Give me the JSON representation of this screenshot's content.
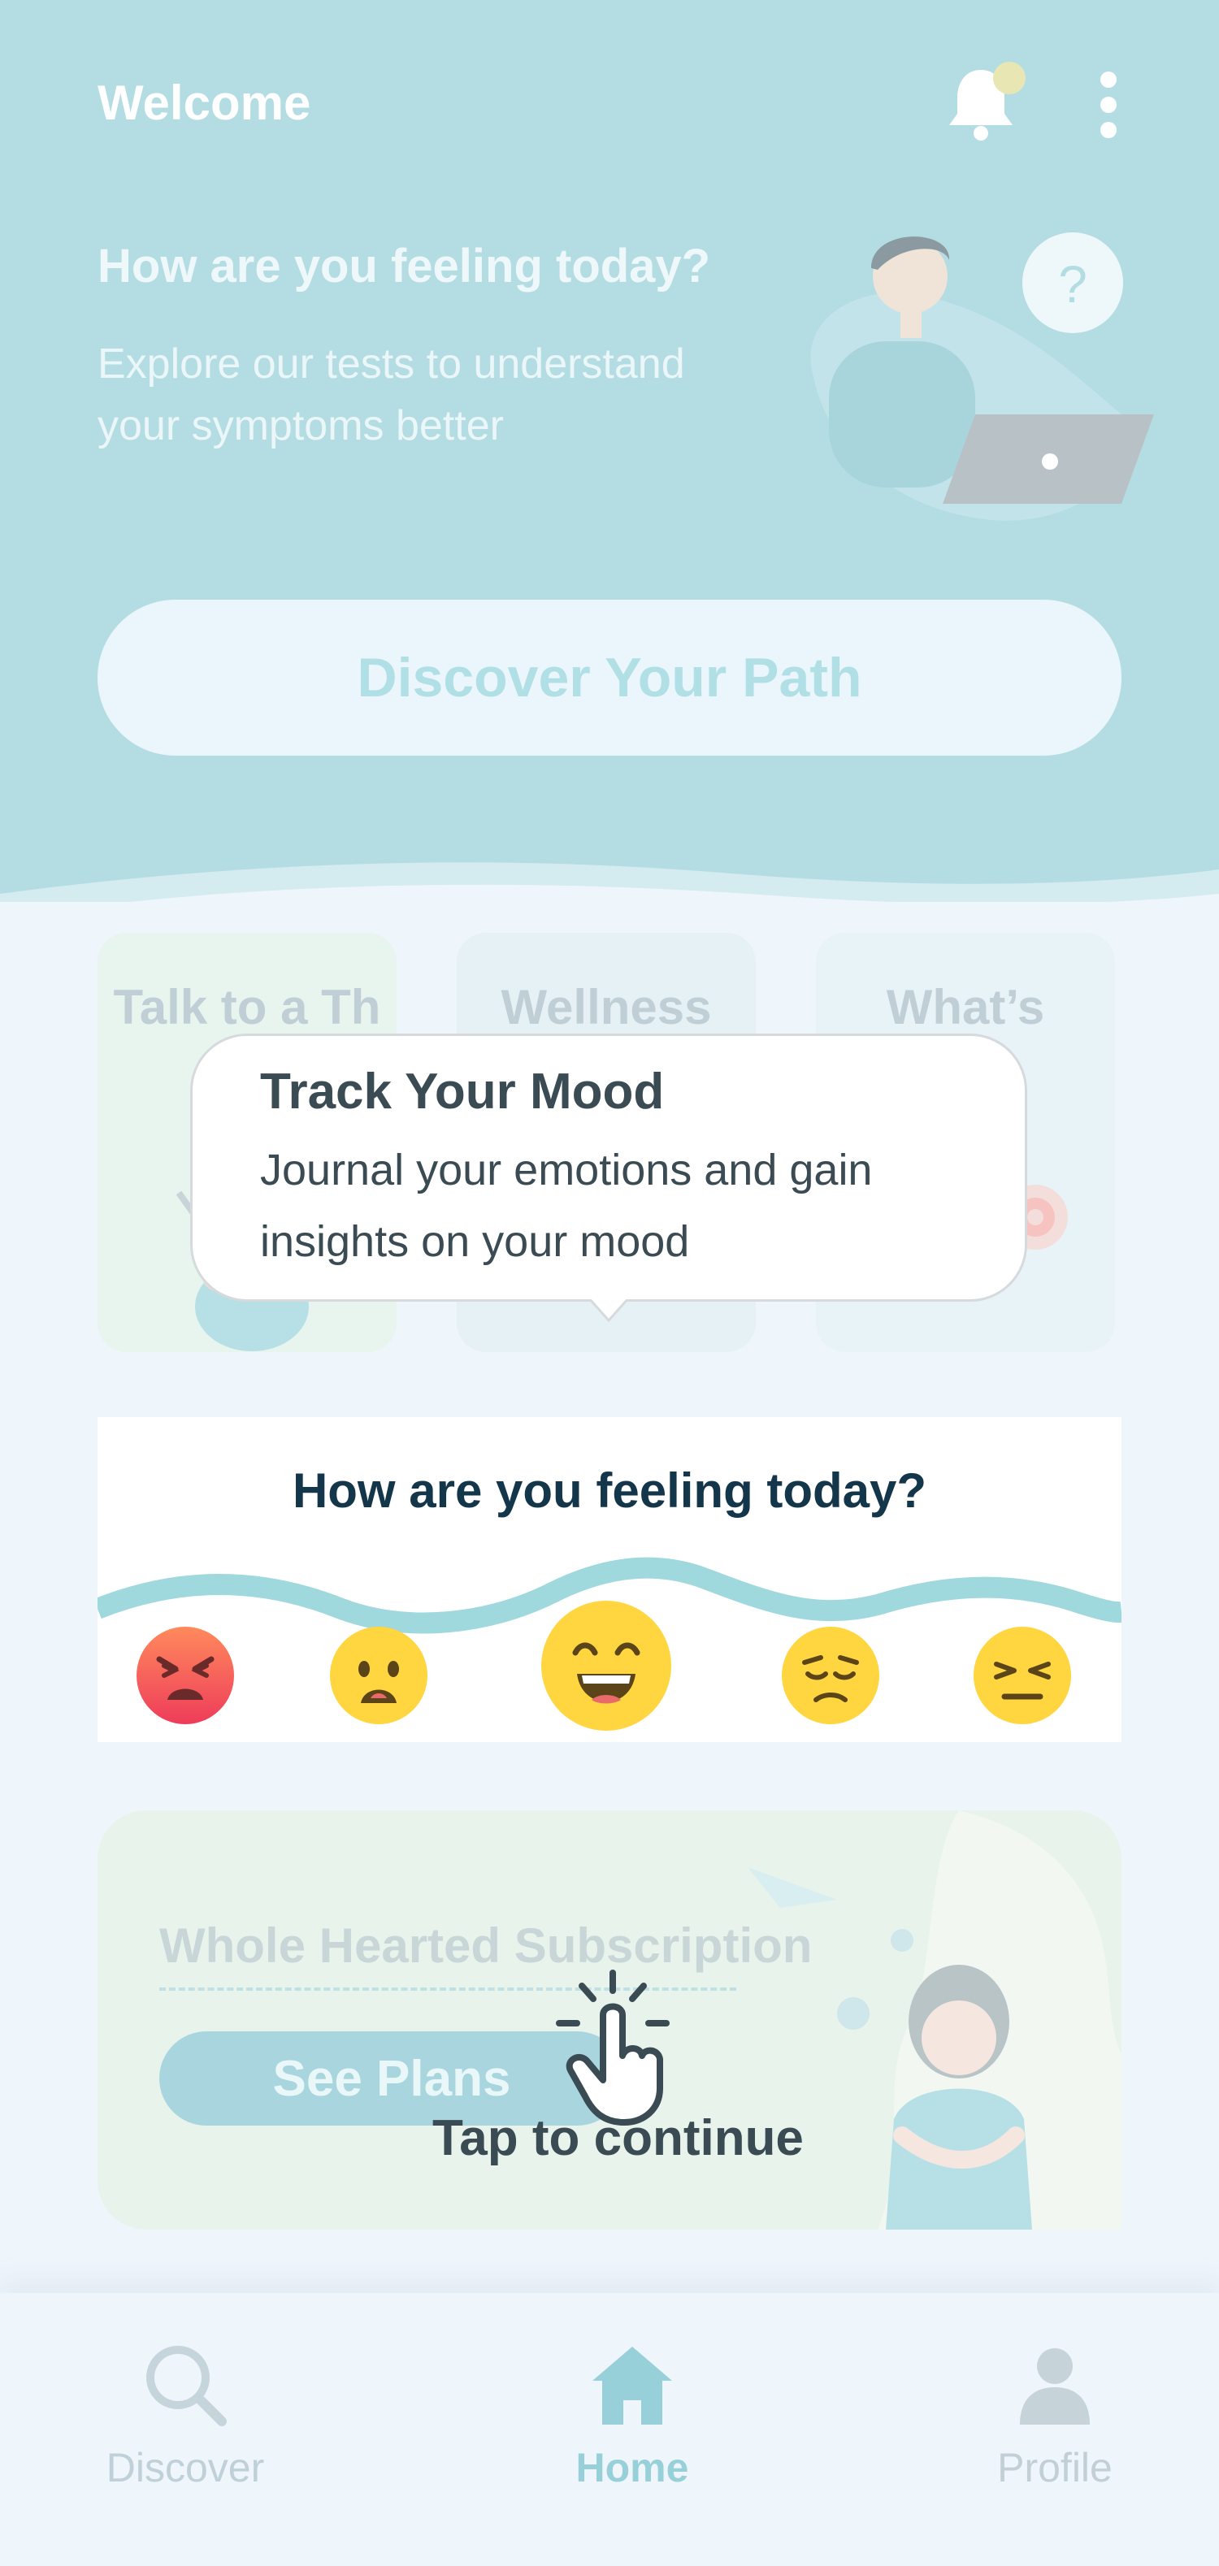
{
  "header": {
    "welcome": "Welcome",
    "question": "How are you feeling today?",
    "subtitle": "Explore our tests to understand your symptoms better",
    "discover_button": "Discover Your Path"
  },
  "cards": [
    {
      "label": "Talk to a Th"
    },
    {
      "label": "Wellness"
    },
    {
      "label": "What’s"
    }
  ],
  "tooltip": {
    "title": "Track Your Mood",
    "body": "Journal your emotions and gain insights on your mood"
  },
  "mood": {
    "title": "How are you feeling today?",
    "emojis": [
      "angry-face-icon",
      "worried-face-icon",
      "happy-face-icon",
      "sad-face-icon",
      "annoyed-face-icon"
    ],
    "selected": "happy-face-icon"
  },
  "subscription": {
    "title": "Whole Hearted Subscription",
    "button": "See Plans"
  },
  "onboarding": {
    "tap_hint": "Tap to continue"
  },
  "nav": {
    "items": [
      {
        "label": "Discover",
        "icon": "search-icon"
      },
      {
        "label": "Home",
        "icon": "home-icon",
        "active": true
      },
      {
        "label": "Profile",
        "icon": "person-icon"
      }
    ]
  },
  "colors": {
    "header_bg": "#b4dde3",
    "accent": "#98d0da",
    "tooltip_text": "#3b4b53",
    "emoji_yellow": "#ffd640",
    "emoji_red": "#f25a5a"
  }
}
